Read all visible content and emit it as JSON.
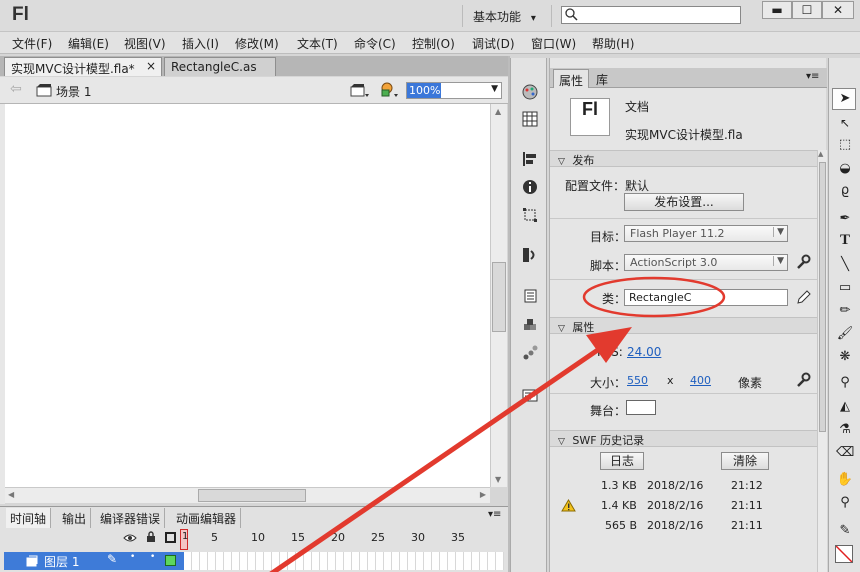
{
  "app": {
    "logo": "Fl",
    "workspace": "基本功能",
    "workspace_arrow": "▾"
  },
  "window": {
    "minimize": "▬",
    "maximize": "☐",
    "close": "✕"
  },
  "menu": [
    "文件(F)",
    "编辑(E)",
    "视图(V)",
    "插入(I)",
    "修改(M)",
    "文本(T)",
    "命令(C)",
    "控制(O)",
    "调试(D)",
    "窗口(W)",
    "帮助(H)"
  ],
  "doc_tabs": [
    {
      "label": "实现MVC设计模型.fla*",
      "close": "×",
      "active": true
    },
    {
      "label": "RectangleC.as",
      "active": false
    }
  ],
  "scene": {
    "label": "场景 1",
    "zoom": "100%"
  },
  "timeline": {
    "tabs": [
      "时间轴",
      "输出",
      "编译器错误",
      "动画编辑器"
    ],
    "frame_numbers": [
      "1",
      "5",
      "10",
      "15",
      "20",
      "25",
      "30",
      "35"
    ],
    "layer_name": "图层 1"
  },
  "properties": {
    "tabs": [
      "属性",
      "库"
    ],
    "doc_type": "文档",
    "doc_icon": "Fl",
    "file_name": "实现MVC设计模型.fla",
    "publish_section": "发布",
    "profile_label": "配置文件：",
    "profile_value": "默认",
    "publish_settings_button": "发布设置...",
    "target_label": "目标：",
    "target_value": "Flash Player 11.2",
    "script_label": "脚本：",
    "script_value": "ActionScript 3.0",
    "class_label": "类：",
    "class_value": "RectangleC",
    "attr_section": "属性",
    "fps_label": "FPS:",
    "fps_value": "24.00",
    "size_label": "大小：",
    "width": "550",
    "x_sep": "x",
    "height": "400",
    "unit": "像素",
    "stage_label": "舞台：",
    "history_section": "SWF 历史记录",
    "log_button": "日志",
    "clear_button": "清除",
    "history": [
      {
        "size": "1.3 KB",
        "date": "2018/2/16",
        "time": "21:12",
        "warn": false
      },
      {
        "size": "1.4 KB",
        "date": "2018/2/16",
        "time": "21:11",
        "warn": true
      },
      {
        "size": "565 B",
        "date": "2018/2/16",
        "time": "21:11",
        "warn": false
      }
    ]
  },
  "colors": {
    "accent": "#3b77d9",
    "annotation": "#e23a2e",
    "stage": "#ffffff"
  }
}
